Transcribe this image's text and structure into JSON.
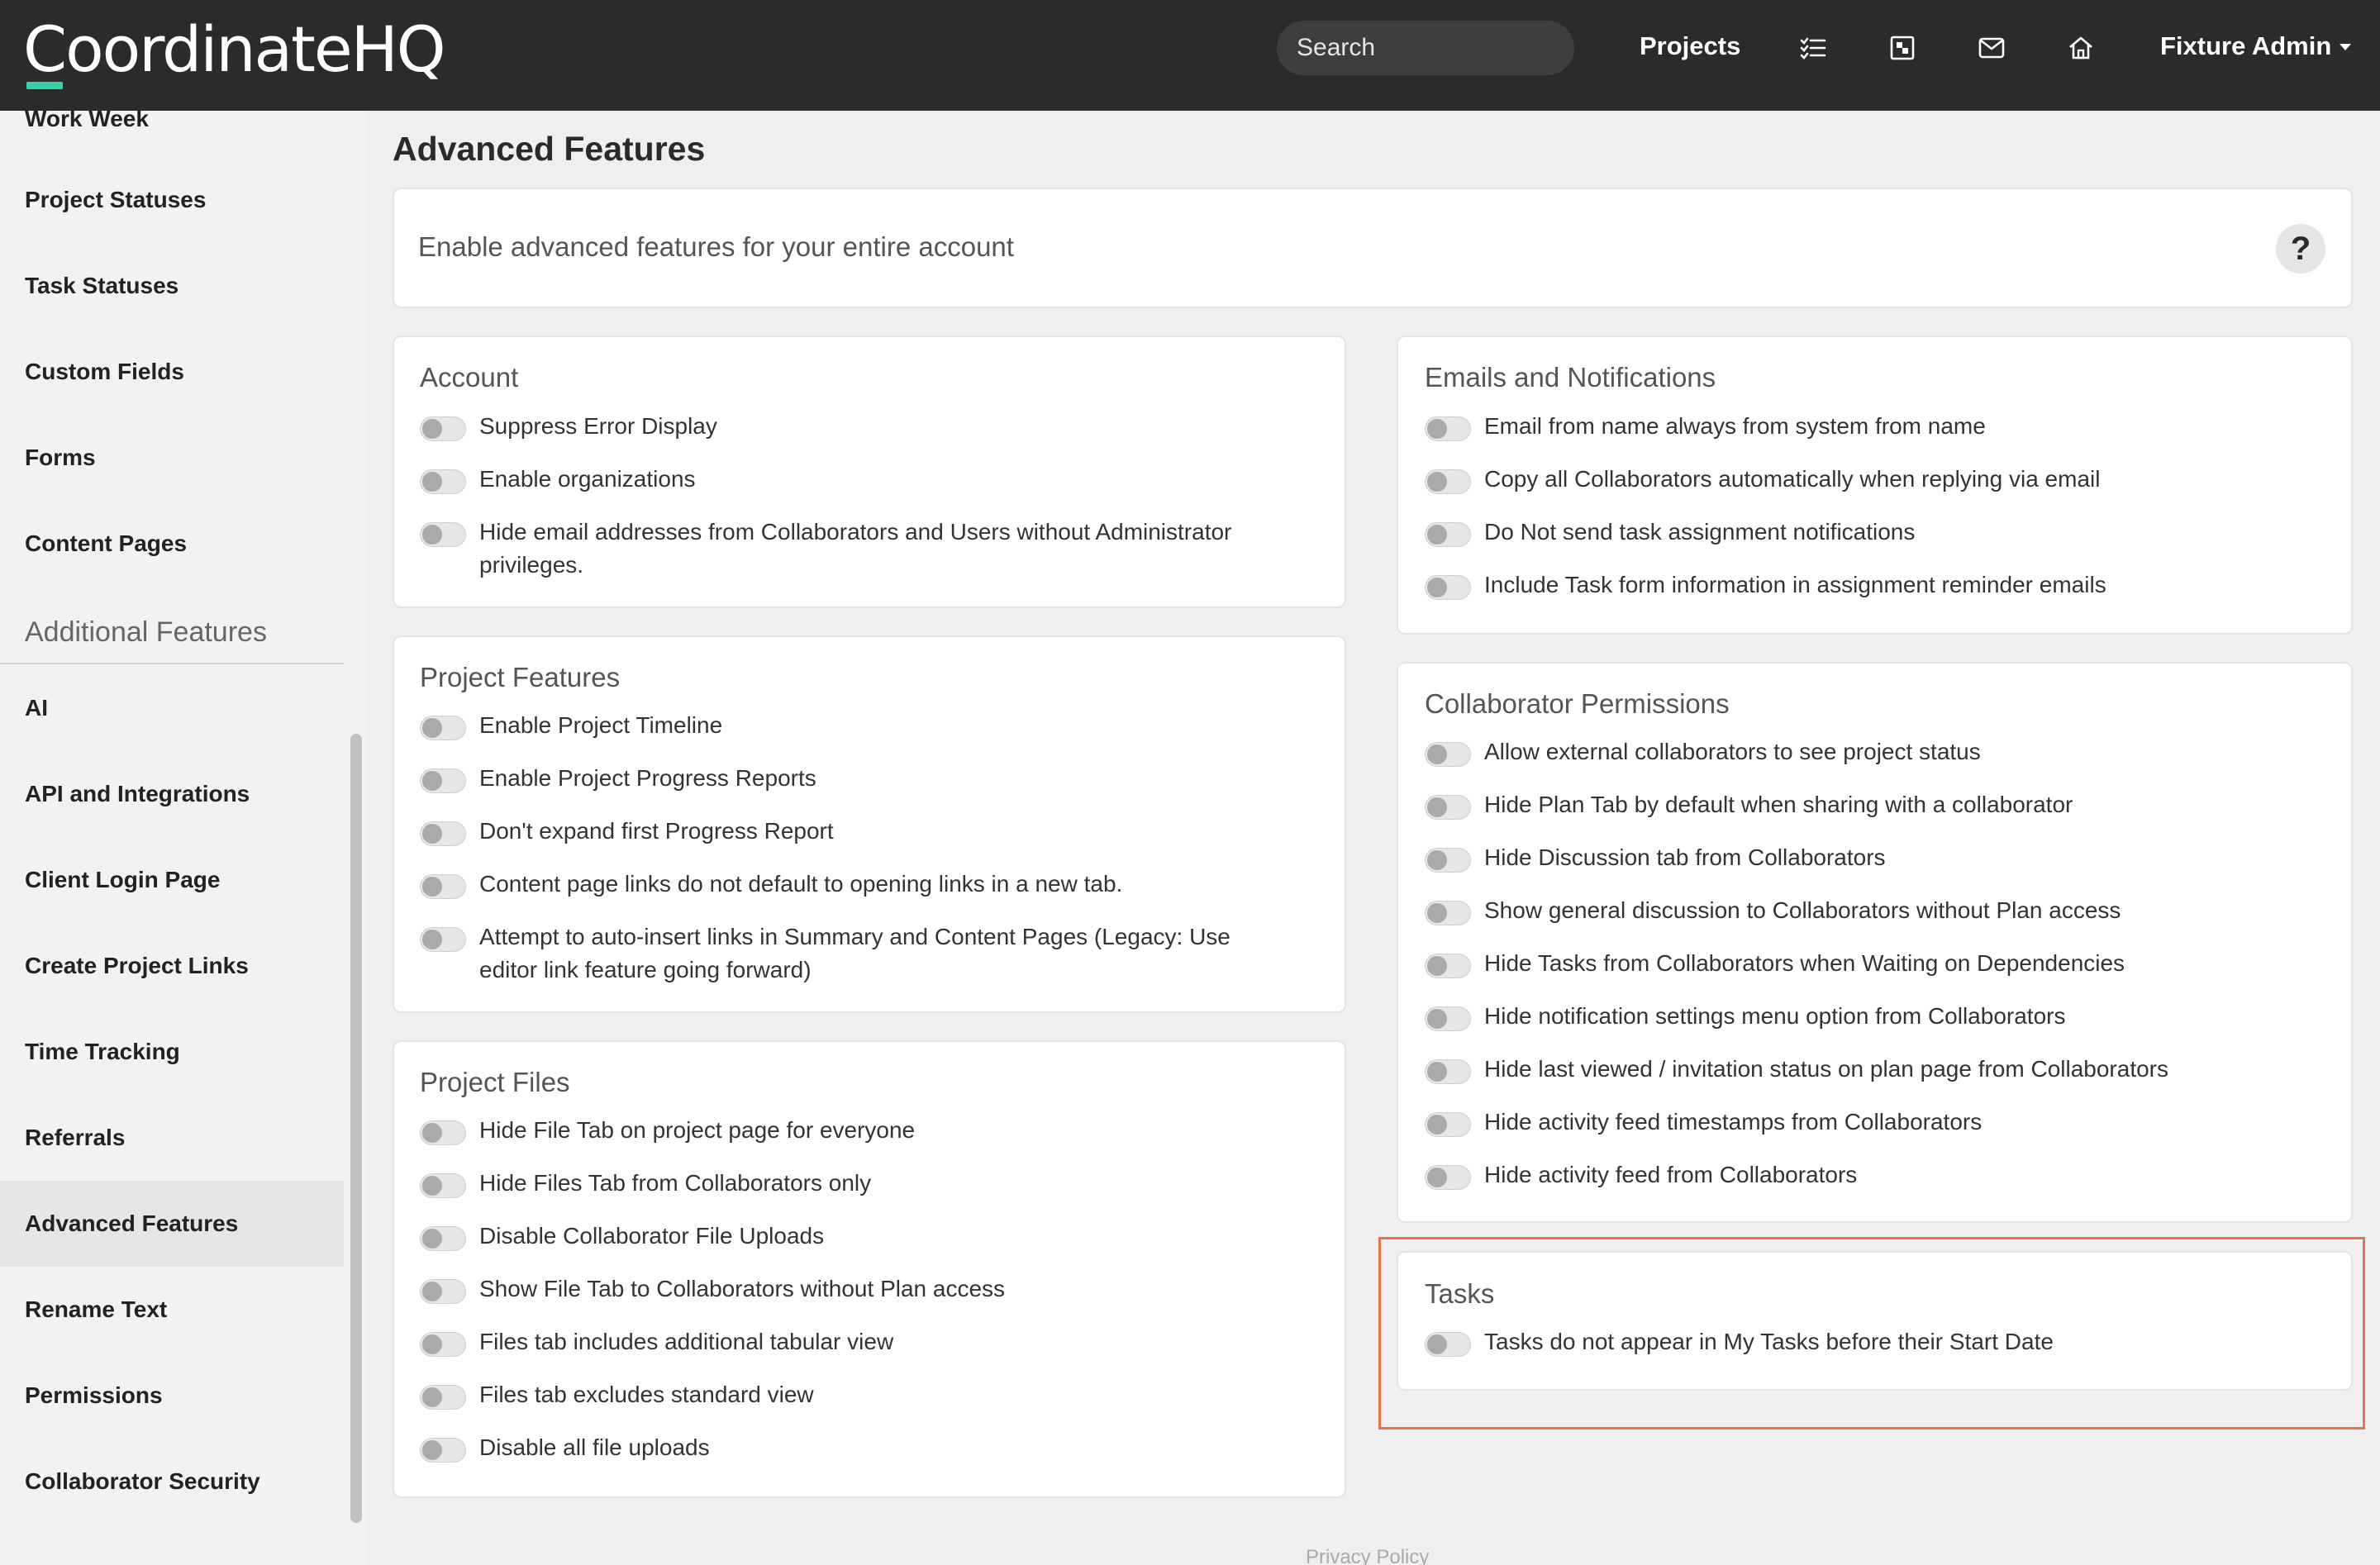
{
  "app": {
    "logo": "CoordinateHQ"
  },
  "topbar": {
    "search_placeholder": "Search",
    "projects_label": "Projects",
    "icons": [
      "tasks-icon",
      "dashboard-icon",
      "mail-icon",
      "home-icon"
    ],
    "user_label": "Fixture Admin"
  },
  "sidebar": {
    "items_top": [
      "Work Week",
      "Project Statuses",
      "Task Statuses",
      "Custom Fields",
      "Forms",
      "Content Pages"
    ],
    "section_heading": "Additional Features",
    "items_additional": [
      "AI",
      "API and Integrations",
      "Client Login Page",
      "Create Project Links",
      "Time Tracking",
      "Referrals",
      "Advanced Features",
      "Rename Text",
      "Permissions",
      "Collaborator Security"
    ],
    "active_item": "Advanced Features"
  },
  "page": {
    "title": "Advanced Features",
    "intro": "Enable advanced features for your entire account",
    "help": "?"
  },
  "cards": {
    "account": {
      "title": "Account",
      "options": [
        "Suppress Error Display",
        "Enable organizations",
        "Hide email addresses from Collaborators and Users without Administrator",
        "privileges."
      ]
    },
    "project_features": {
      "title": "Project Features",
      "options": [
        "Enable Project Timeline",
        "Enable Project Progress Reports",
        "Don't expand first Progress Report",
        "Content page links do not default to opening links in a new tab.",
        "Attempt to auto-insert links in Summary and Content Pages (Legacy: Use",
        "editor link feature going forward)"
      ]
    },
    "project_files": {
      "title": "Project Files",
      "options": [
        "Hide File Tab on project page for everyone",
        "Hide Files Tab from Collaborators only",
        "Disable Collaborator File Uploads",
        "Show File Tab to Collaborators without Plan access",
        "Files tab includes additional tabular view",
        "Files tab excludes standard view",
        "Disable all file uploads"
      ]
    },
    "emails": {
      "title": "Emails and Notifications",
      "options": [
        "Email from name always from system from name",
        "Copy all Collaborators automatically when replying via email",
        "Do Not send task assignment notifications",
        "Include Task form information in assignment reminder emails"
      ]
    },
    "collab_perms": {
      "title": "Collaborator Permissions",
      "options": [
        "Allow external collaborators to see project status",
        "Hide Plan Tab by default when sharing with a collaborator",
        "Hide Discussion tab from Collaborators",
        "Show general discussion to Collaborators without Plan access",
        "Hide Tasks from Collaborators when Waiting on Dependencies",
        "Hide notification settings menu option from Collaborators",
        "Hide last viewed / invitation status on plan page from Collaborators",
        "Hide activity feed timestamps from Collaborators",
        "Hide activity feed from Collaborators"
      ]
    },
    "tasks": {
      "title": "Tasks",
      "options": [
        "Tasks do not appear in My Tasks before their Start Date"
      ]
    }
  },
  "footer": {
    "privacy": "Privacy Policy"
  },
  "colors": {
    "topbar": "#2b2b2b",
    "accent": "#35d0a5",
    "highlight": "#e8734a"
  }
}
